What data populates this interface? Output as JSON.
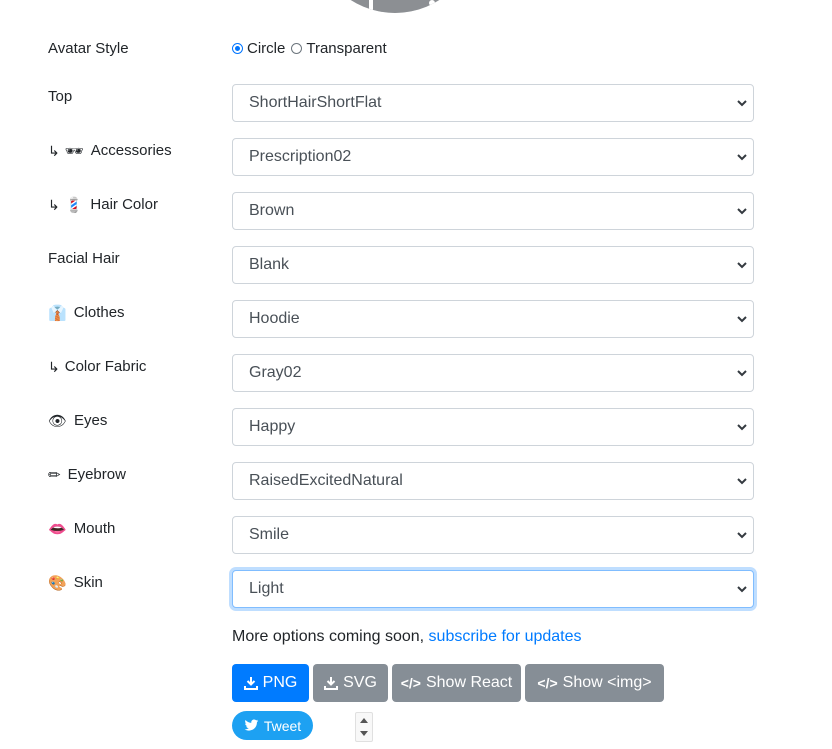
{
  "avatar_style": {
    "label": "Avatar Style",
    "options": [
      {
        "label": "Circle",
        "checked": true
      },
      {
        "label": "Transparent",
        "checked": false
      }
    ]
  },
  "fields": [
    {
      "label": "Top",
      "prefix": "",
      "icon": "",
      "value": "ShortHairShortFlat"
    },
    {
      "label": "Accessories",
      "prefix": "↳",
      "icon": "🕶",
      "value": "Prescription02"
    },
    {
      "label": "Hair Color",
      "prefix": "↳",
      "icon": "💈",
      "value": "Brown"
    },
    {
      "label": "Facial Hair",
      "prefix": "",
      "icon": "",
      "value": "Blank"
    },
    {
      "label": "Clothes",
      "prefix": "",
      "icon": "👔",
      "value": "Hoodie"
    },
    {
      "label": "Color Fabric",
      "prefix": "↳",
      "icon": "",
      "value": "Gray02"
    },
    {
      "label": "Eyes",
      "prefix": "",
      "icon": "👁",
      "value": "Happy"
    },
    {
      "label": "Eyebrow",
      "prefix": "",
      "icon": "✏",
      "value": "RaisedExcitedNatural"
    },
    {
      "label": "Mouth",
      "prefix": "",
      "icon": "👄",
      "value": "Smile"
    },
    {
      "label": "Skin",
      "prefix": "",
      "icon": "🎨",
      "value": "Light"
    }
  ],
  "more_options": {
    "text": "More options coming soon, ",
    "link": "subscribe for updates"
  },
  "buttons": {
    "png": "PNG",
    "svg": "SVG",
    "react": "Show React",
    "img": "Show <img>"
  },
  "tweet": "Tweet"
}
